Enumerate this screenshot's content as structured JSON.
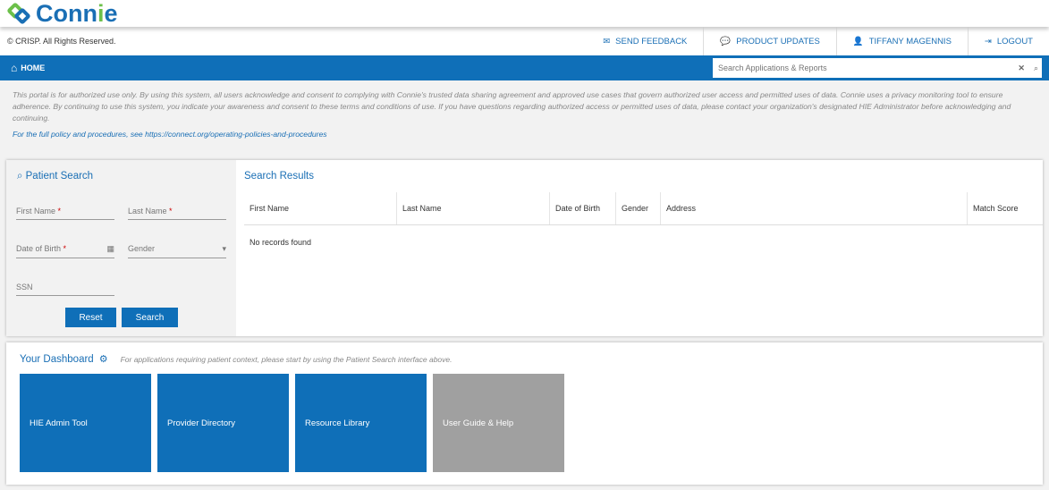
{
  "brand": {
    "name_pre": "Conn",
    "name_i": "i",
    "name_post": "e"
  },
  "topbar": {
    "copyright": "© CRISP. All Rights Reserved.",
    "links": [
      "SEND FEEDBACK",
      "PRODUCT UPDATES",
      "TIFFANY MAGENNIS",
      "LOGOUT"
    ]
  },
  "nav": {
    "home": "HOME",
    "search_placeholder": "Search Applications & Reports"
  },
  "notice": "This portal is for authorized use only. By using this system, all users acknowledge and consent to complying with Connie's trusted data sharing agreement and approved use cases that govern authorized user access and permitted uses of data. Connie uses a privacy monitoring tool to ensure adherence. By continuing to use this system, you indicate your awareness and consent to these terms and conditions of use. If you have questions regarding authorized access or permitted uses of data, please contact your organization's designated HIE Administrator before acknowledging and continuing.",
  "policy": "For the full policy and procedures, see https://connect.org/operating-policies-and-procedures",
  "patient_search": {
    "title": "Patient Search",
    "first_name": "First Name",
    "last_name": "Last Name",
    "dob": "Date of Birth",
    "gender": "Gender",
    "ssn": "SSN",
    "reset": "Reset",
    "search": "Search"
  },
  "results": {
    "title": "Search Results",
    "columns": [
      "First Name",
      "Last Name",
      "Date of Birth",
      "Gender",
      "Address",
      "Match Score"
    ],
    "empty": "No records found"
  },
  "dashboard": {
    "title": "Your Dashboard",
    "hint": "For applications requiring patient context, please start by using the Patient Search interface above.",
    "tiles": [
      "HIE Admin Tool",
      "Provider Directory",
      "Resource Library",
      "User Guide & Help"
    ]
  },
  "colors": {
    "primary": "#0f6fb8",
    "green": "#6cc04a",
    "tile_disabled": "#a0a0a0"
  }
}
